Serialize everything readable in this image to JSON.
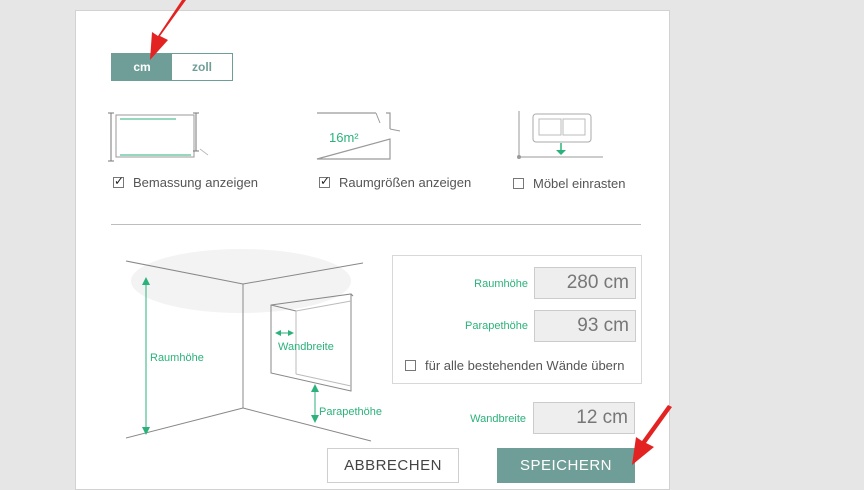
{
  "units": {
    "cm": "cm",
    "inch": "zoll",
    "selected": "cm"
  },
  "options": [
    {
      "label": "Bemassung anzeigen",
      "checked": true
    },
    {
      "label": "Raumgrößen anzeigen",
      "checked": true,
      "area_text": "16m²"
    },
    {
      "label": "Möbel einrasten",
      "checked": false
    }
  ],
  "illustration": {
    "height_label": "Raumhöhe",
    "width_label": "Wandbreite",
    "sill_label": "Parapethöhe"
  },
  "fields": {
    "room_height": {
      "label": "Raumhöhe",
      "value": "280 cm"
    },
    "sill_height": {
      "label": "Parapethöhe",
      "value": "93 cm"
    },
    "apply_all_label": "für alle bestehenden Wände übern",
    "wall_width": {
      "label": "Wandbreite",
      "value": "12 cm"
    }
  },
  "buttons": {
    "cancel": "ABBRECHEN",
    "save": "SPEICHERN"
  },
  "colors": {
    "accent": "#6f9e98",
    "green": "#2bb27b",
    "arrow": "#e32222"
  }
}
